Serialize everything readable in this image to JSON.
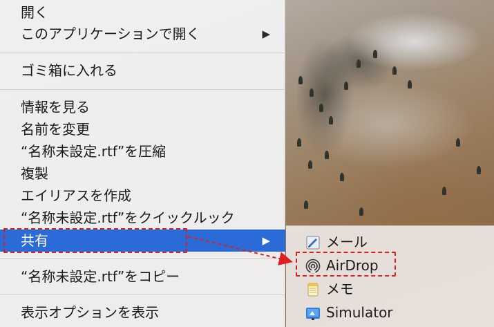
{
  "menu": {
    "items": [
      {
        "label": "開く"
      },
      {
        "label": "このアプリケーションで開く",
        "submenu_arrow": "▶"
      },
      {
        "label": "ゴミ箱に入れる"
      },
      {
        "label": "情報を見る"
      },
      {
        "label": "名前を変更"
      },
      {
        "label": "“名称未設定.rtf”を圧縮"
      },
      {
        "label": "複製"
      },
      {
        "label": "エイリアスを作成"
      },
      {
        "label": "“名称未設定.rtf”をクイックルック"
      },
      {
        "label": "共有",
        "submenu_arrow": "▶"
      },
      {
        "label": "“名称未設定.rtf”をコピー"
      },
      {
        "label": "表示オプションを表示"
      }
    ],
    "selected_index": 9,
    "accent_color": "#2a6bd8"
  },
  "share_submenu": {
    "items": [
      {
        "label": "メール",
        "icon": "mail-icon"
      },
      {
        "label": "AirDrop",
        "icon": "airdrop-icon"
      },
      {
        "label": "メモ",
        "icon": "notes-icon"
      },
      {
        "label": "Simulator",
        "icon": "simulator-icon"
      }
    ]
  },
  "annotation": {
    "color": "#e02020"
  }
}
